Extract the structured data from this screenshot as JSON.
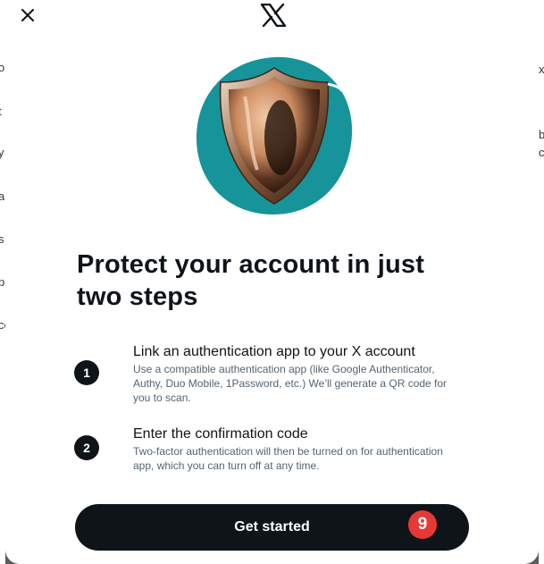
{
  "backdrop": {
    "left_fragments": [
      "i",
      "o",
      "t",
      "y",
      "a",
      "s",
      "p",
      "ce"
    ],
    "right_fragments": [
      "x",
      "b",
      "c"
    ]
  },
  "modal": {
    "close_icon": "close-icon",
    "logo_icon": "x-logo-icon",
    "hero_image": "shield-illustration",
    "title": "Protect your account in just two steps",
    "steps": [
      {
        "number": "1",
        "heading": "Link an authentication app to your X account",
        "description": "Use a compatible authentication app (like Google Authenticator, Authy, Duo Mobile, 1Password, etc.) We’ll generate a QR code for you to scan."
      },
      {
        "number": "2",
        "heading": "Enter the confirmation code",
        "description": "Two-factor authentication will then be turned on for authentication app, which you can turn off at any time."
      }
    ],
    "cta_label": "Get started",
    "marker": "9"
  },
  "colors": {
    "primary": "#0f1419",
    "secondary_text": "#536471",
    "teal": "#17939a",
    "marker": "#e53935"
  }
}
